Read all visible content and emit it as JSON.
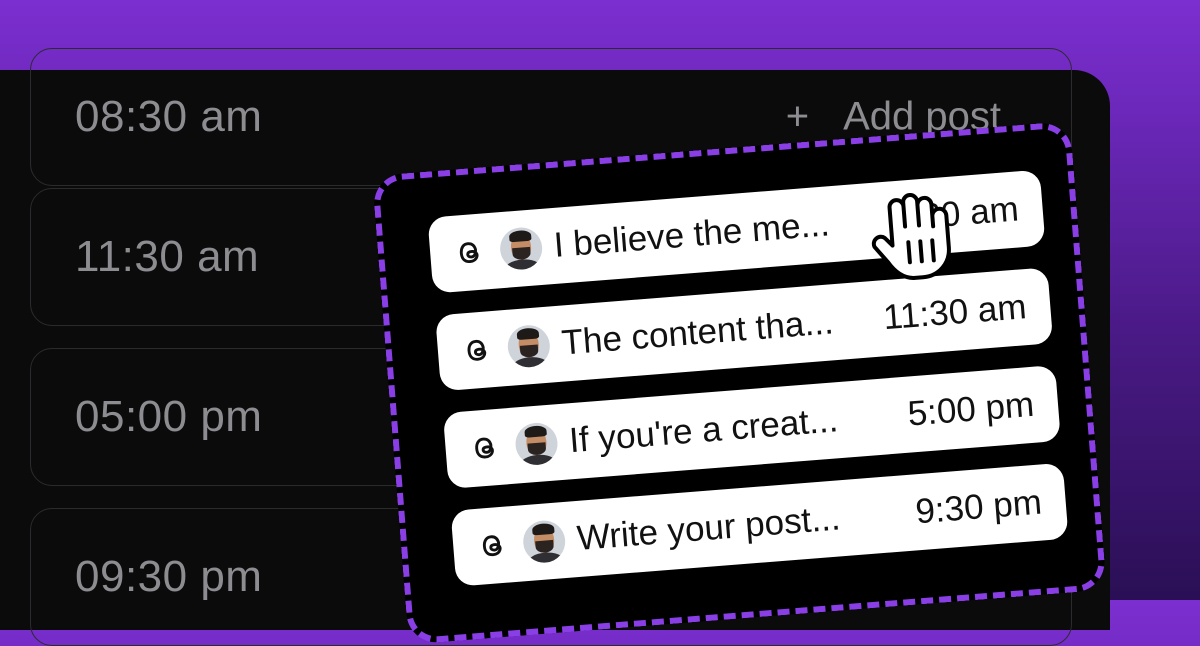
{
  "slots": [
    {
      "time": "08:30 am",
      "add_label": "Add post"
    },
    {
      "time": "11:30 am"
    },
    {
      "time": "05:00 pm"
    },
    {
      "time": "09:30 pm"
    }
  ],
  "queue": {
    "posts": [
      {
        "text": "I believe the me...",
        "time": "8:30 am"
      },
      {
        "text": "The content tha...",
        "time": "11:30 am"
      },
      {
        "text": "If you're a creat...",
        "time": "5:00 pm"
      },
      {
        "text": "Write your post...",
        "time": "9:30 pm"
      }
    ]
  },
  "icons": {
    "post_platform": "threads-icon",
    "add": "plus-icon",
    "cursor": "grab-hand-cursor-icon"
  },
  "colors": {
    "accent": "#8a3fe6",
    "background_top": "#7c2fd0",
    "panel": "#0b0b0c"
  }
}
